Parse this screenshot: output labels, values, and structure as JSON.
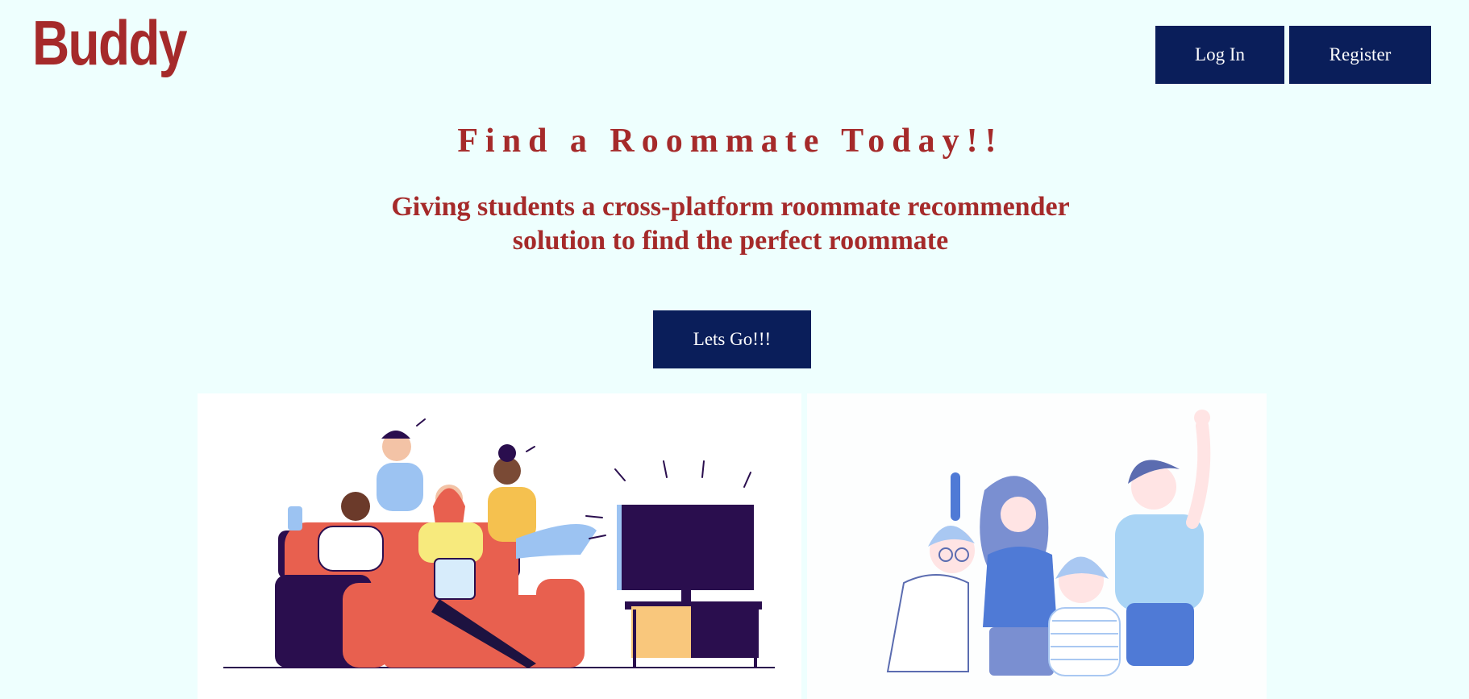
{
  "header": {
    "logo_text": "Buddy",
    "login_label": "Log In",
    "register_label": "Register"
  },
  "hero": {
    "title": "Find a Roommate Today!!",
    "subtitle_line1": "Giving students a cross-platform roommate recommender",
    "subtitle_line2": "solution to find the perfect roommate",
    "cta_label": "Lets Go!!!"
  },
  "colors": {
    "background": "#eefffe",
    "brand_red": "#a52a2a",
    "button_navy": "#0a1e5a"
  },
  "illustrations": [
    "friends-watching-tv-illustration",
    "happy-friends-group-illustration"
  ]
}
